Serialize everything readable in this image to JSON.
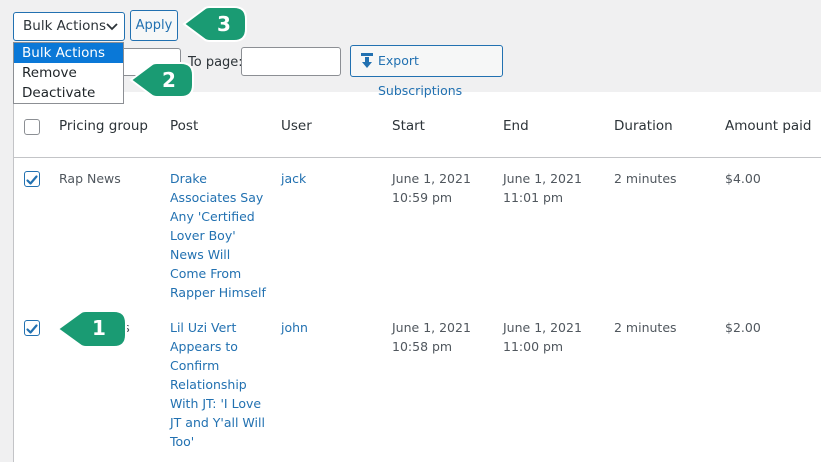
{
  "toolbar": {
    "bulk_select_value": "Bulk Actions",
    "apply_label": "Apply",
    "bulk_options": [
      "Bulk Actions",
      "Remove",
      "Deactivate"
    ],
    "to_page_label": "To page:",
    "export_label": "Export Subscriptions"
  },
  "table": {
    "headers": [
      "Pricing group",
      "Post",
      "User",
      "Start",
      "End",
      "Duration",
      "Amount paid"
    ],
    "rows": [
      {
        "checked": true,
        "group": "Rap News",
        "post": [
          "Drake",
          "Associates Say",
          "Any 'Certified",
          "Lover Boy'",
          "News Will",
          "Come From",
          "Rapper Himself"
        ],
        "user": "jack",
        "start": [
          "June 1, 2021",
          "10:59 pm"
        ],
        "end": [
          "June 1, 2021",
          "11:01 pm"
        ],
        "duration": "2 minutes",
        "amount": "$4.00"
      },
      {
        "checked": true,
        "group_partial": "ws",
        "post": [
          "Lil Uzi Vert",
          "Appears to",
          "Confirm",
          "Relationship",
          "With JT: 'I Love",
          "JT and Y'all Will",
          "Too'"
        ],
        "user": "john",
        "start": [
          "June 1, 2021",
          "10:58 pm"
        ],
        "end": [
          "June 1, 2021",
          "11:00 pm"
        ],
        "duration": "2 minutes",
        "amount": "$2.00"
      }
    ]
  },
  "callouts": [
    "1",
    "2",
    "3"
  ],
  "colors": {
    "accent": "#2271b1",
    "callout": "#1a9b73",
    "selected": "#0a78d7"
  }
}
